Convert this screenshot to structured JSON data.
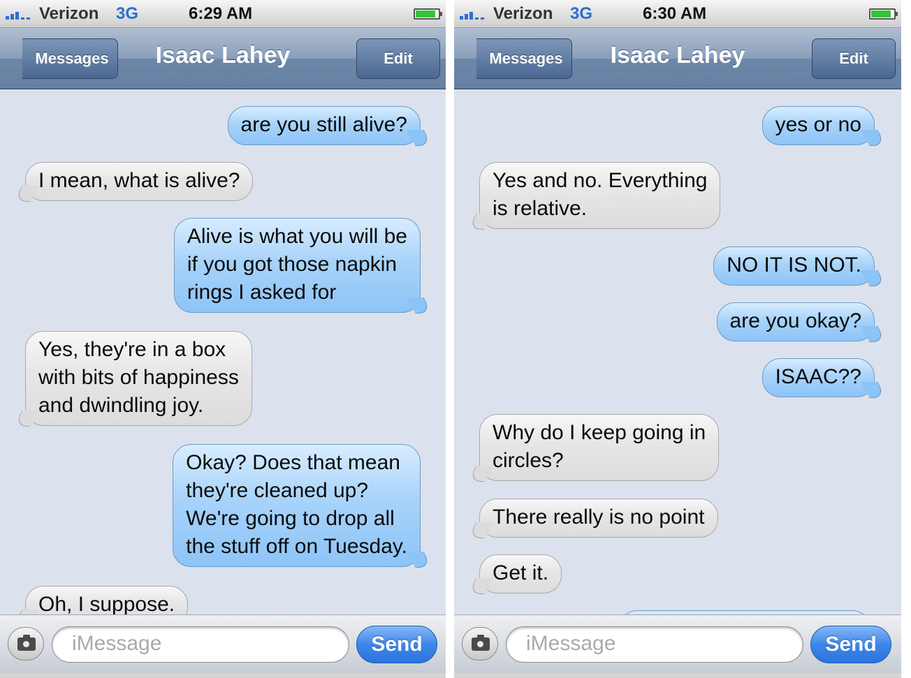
{
  "screens": [
    {
      "status": {
        "carrier": "Verizon",
        "network": "3G",
        "time": "6:29 AM"
      },
      "nav": {
        "back_label": "Messages",
        "title": "Isaac Lahey",
        "edit_label": "Edit"
      },
      "messages": [
        {
          "side": "out",
          "text": "are you still alive?"
        },
        {
          "side": "in",
          "text": "I mean, what is alive?"
        },
        {
          "side": "out",
          "text": "Alive is what you will be\nif you got those napkin\nrings I asked for"
        },
        {
          "side": "in",
          "text": "Yes, they're in a box\nwith bits of happiness\nand dwindling joy."
        },
        {
          "side": "out",
          "text": "Okay? Does that mean\nthey're cleaned up?\nWe're going to drop all\nthe stuff off on Tuesday."
        },
        {
          "side": "in",
          "text": "Oh, I suppose."
        }
      ],
      "input": {
        "placeholder": "iMessage",
        "send_label": "Send"
      }
    },
    {
      "status": {
        "carrier": "Verizon",
        "network": "3G",
        "time": "6:30 AM"
      },
      "nav": {
        "back_label": "Messages",
        "title": "Isaac Lahey",
        "edit_label": "Edit"
      },
      "messages": [
        {
          "side": "out",
          "text": "yes or no"
        },
        {
          "side": "in",
          "text": "Yes and no. Everything\nis relative."
        },
        {
          "side": "out",
          "text": "NO IT IS NOT."
        },
        {
          "side": "out",
          "text": "are you okay?"
        },
        {
          "side": "out",
          "text": "ISAAC??"
        },
        {
          "side": "in",
          "text": "Why do I keep going in\ncircles?"
        },
        {
          "side": "in",
          "text": "There really is no point"
        },
        {
          "side": "in",
          "text": "Get it."
        }
      ],
      "input": {
        "placeholder": "iMessage",
        "send_label": "Send"
      }
    }
  ]
}
